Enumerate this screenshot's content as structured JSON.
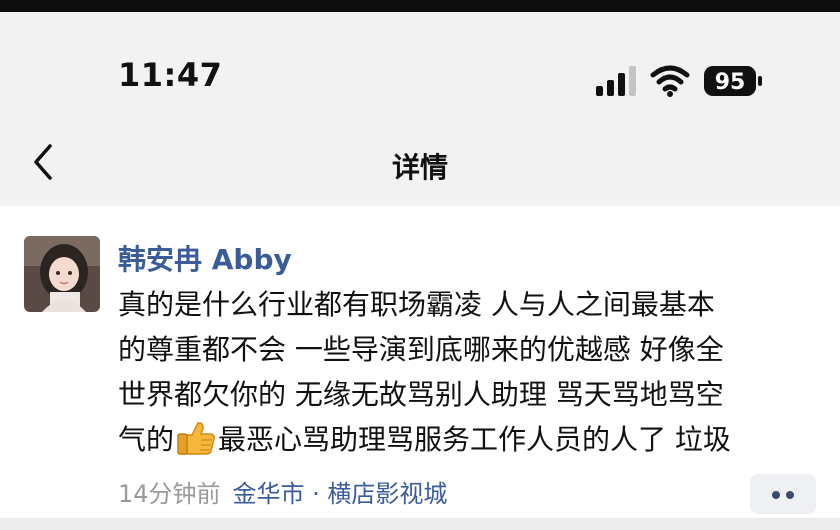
{
  "status_bar": {
    "time": "11:47",
    "battery_level": "95",
    "signal_icon": "cellular-signal-icon",
    "wifi_icon": "wifi-icon"
  },
  "nav": {
    "title": "详情",
    "back_icon": "chevron-left-icon"
  },
  "post": {
    "author": "韩安冉 Abby",
    "content_lines": [
      "真的是什么行业都有职场霸凌 人与人之间最基本",
      "的尊重都不会  一些导演到底哪来的优越感 好像全",
      "世界都欠你的 无缘无故骂别人助理 骂天骂地骂空",
      "最恶心骂助理骂服务工作人员的人了 垃圾"
    ],
    "line4_prefix": "气的",
    "emoji": "thumbs-up-emoji",
    "time_ago": "14分钟前",
    "location": "金华市 · 横店影视城",
    "more_icon": "more-dots-icon"
  },
  "colors": {
    "link": "#3a5c9b",
    "muted": "#9a9a9a",
    "background": "#f2f2f2",
    "card": "#ffffff"
  }
}
